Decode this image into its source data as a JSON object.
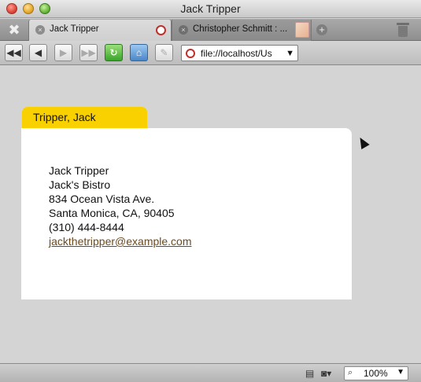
{
  "window": {
    "title": "Jack Tripper"
  },
  "tabs": [
    {
      "label": "Jack Tripper",
      "active": true
    },
    {
      "label": "Christopher Schmitt : ...",
      "active": false
    }
  ],
  "toolbar": {
    "address": "file://localhost/Us",
    "buttons": [
      "rewind-icon",
      "back-icon",
      "forward-icon",
      "fast-forward-icon",
      "reload-icon",
      "home-icon",
      "pencil-icon"
    ]
  },
  "contact": {
    "tab_label": "Tripper, Jack",
    "name": "Jack Tripper",
    "organization": "Jack's Bistro",
    "street": "834 Ocean Vista Ave.",
    "locality": "Santa Monica, CA, 90405",
    "phone": "(310) 444-8444",
    "email": "jackthetripper@example.com"
  },
  "statusbar": {
    "zoom": "100%"
  },
  "colors": {
    "card_tab": "#f9d100",
    "page_bg": "#d4d4d4",
    "email_link": "#6b4a1e"
  }
}
